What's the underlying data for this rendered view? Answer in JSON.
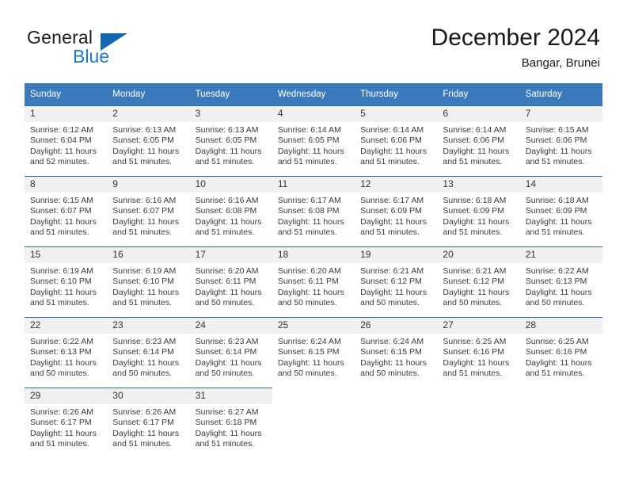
{
  "brand": {
    "name_top": "General",
    "name_bottom": "Blue",
    "accent_color": "#1a7ac4",
    "triangle_color": "#1368b0"
  },
  "header": {
    "title": "December 2024",
    "subtitle": "Bangar, Brunei"
  },
  "calendar": {
    "header_color": "#3b79bd",
    "daynum_band_color": "#f0f0f0",
    "weekdays": [
      "Sunday",
      "Monday",
      "Tuesday",
      "Wednesday",
      "Thursday",
      "Friday",
      "Saturday"
    ],
    "weeks": [
      [
        {
          "day": "1",
          "sunrise": "Sunrise: 6:12 AM",
          "sunset": "Sunset: 6:04 PM",
          "daylight": "Daylight: 11 hours and 52 minutes."
        },
        {
          "day": "2",
          "sunrise": "Sunrise: 6:13 AM",
          "sunset": "Sunset: 6:05 PM",
          "daylight": "Daylight: 11 hours and 51 minutes."
        },
        {
          "day": "3",
          "sunrise": "Sunrise: 6:13 AM",
          "sunset": "Sunset: 6:05 PM",
          "daylight": "Daylight: 11 hours and 51 minutes."
        },
        {
          "day": "4",
          "sunrise": "Sunrise: 6:14 AM",
          "sunset": "Sunset: 6:05 PM",
          "daylight": "Daylight: 11 hours and 51 minutes."
        },
        {
          "day": "5",
          "sunrise": "Sunrise: 6:14 AM",
          "sunset": "Sunset: 6:06 PM",
          "daylight": "Daylight: 11 hours and 51 minutes."
        },
        {
          "day": "6",
          "sunrise": "Sunrise: 6:14 AM",
          "sunset": "Sunset: 6:06 PM",
          "daylight": "Daylight: 11 hours and 51 minutes."
        },
        {
          "day": "7",
          "sunrise": "Sunrise: 6:15 AM",
          "sunset": "Sunset: 6:06 PM",
          "daylight": "Daylight: 11 hours and 51 minutes."
        }
      ],
      [
        {
          "day": "8",
          "sunrise": "Sunrise: 6:15 AM",
          "sunset": "Sunset: 6:07 PM",
          "daylight": "Daylight: 11 hours and 51 minutes."
        },
        {
          "day": "9",
          "sunrise": "Sunrise: 6:16 AM",
          "sunset": "Sunset: 6:07 PM",
          "daylight": "Daylight: 11 hours and 51 minutes."
        },
        {
          "day": "10",
          "sunrise": "Sunrise: 6:16 AM",
          "sunset": "Sunset: 6:08 PM",
          "daylight": "Daylight: 11 hours and 51 minutes."
        },
        {
          "day": "11",
          "sunrise": "Sunrise: 6:17 AM",
          "sunset": "Sunset: 6:08 PM",
          "daylight": "Daylight: 11 hours and 51 minutes."
        },
        {
          "day": "12",
          "sunrise": "Sunrise: 6:17 AM",
          "sunset": "Sunset: 6:09 PM",
          "daylight": "Daylight: 11 hours and 51 minutes."
        },
        {
          "day": "13",
          "sunrise": "Sunrise: 6:18 AM",
          "sunset": "Sunset: 6:09 PM",
          "daylight": "Daylight: 11 hours and 51 minutes."
        },
        {
          "day": "14",
          "sunrise": "Sunrise: 6:18 AM",
          "sunset": "Sunset: 6:09 PM",
          "daylight": "Daylight: 11 hours and 51 minutes."
        }
      ],
      [
        {
          "day": "15",
          "sunrise": "Sunrise: 6:19 AM",
          "sunset": "Sunset: 6:10 PM",
          "daylight": "Daylight: 11 hours and 51 minutes."
        },
        {
          "day": "16",
          "sunrise": "Sunrise: 6:19 AM",
          "sunset": "Sunset: 6:10 PM",
          "daylight": "Daylight: 11 hours and 51 minutes."
        },
        {
          "day": "17",
          "sunrise": "Sunrise: 6:20 AM",
          "sunset": "Sunset: 6:11 PM",
          "daylight": "Daylight: 11 hours and 50 minutes."
        },
        {
          "day": "18",
          "sunrise": "Sunrise: 6:20 AM",
          "sunset": "Sunset: 6:11 PM",
          "daylight": "Daylight: 11 hours and 50 minutes."
        },
        {
          "day": "19",
          "sunrise": "Sunrise: 6:21 AM",
          "sunset": "Sunset: 6:12 PM",
          "daylight": "Daylight: 11 hours and 50 minutes."
        },
        {
          "day": "20",
          "sunrise": "Sunrise: 6:21 AM",
          "sunset": "Sunset: 6:12 PM",
          "daylight": "Daylight: 11 hours and 50 minutes."
        },
        {
          "day": "21",
          "sunrise": "Sunrise: 6:22 AM",
          "sunset": "Sunset: 6:13 PM",
          "daylight": "Daylight: 11 hours and 50 minutes."
        }
      ],
      [
        {
          "day": "22",
          "sunrise": "Sunrise: 6:22 AM",
          "sunset": "Sunset: 6:13 PM",
          "daylight": "Daylight: 11 hours and 50 minutes."
        },
        {
          "day": "23",
          "sunrise": "Sunrise: 6:23 AM",
          "sunset": "Sunset: 6:14 PM",
          "daylight": "Daylight: 11 hours and 50 minutes."
        },
        {
          "day": "24",
          "sunrise": "Sunrise: 6:23 AM",
          "sunset": "Sunset: 6:14 PM",
          "daylight": "Daylight: 11 hours and 50 minutes."
        },
        {
          "day": "25",
          "sunrise": "Sunrise: 6:24 AM",
          "sunset": "Sunset: 6:15 PM",
          "daylight": "Daylight: 11 hours and 50 minutes."
        },
        {
          "day": "26",
          "sunrise": "Sunrise: 6:24 AM",
          "sunset": "Sunset: 6:15 PM",
          "daylight": "Daylight: 11 hours and 50 minutes."
        },
        {
          "day": "27",
          "sunrise": "Sunrise: 6:25 AM",
          "sunset": "Sunset: 6:16 PM",
          "daylight": "Daylight: 11 hours and 51 minutes."
        },
        {
          "day": "28",
          "sunrise": "Sunrise: 6:25 AM",
          "sunset": "Sunset: 6:16 PM",
          "daylight": "Daylight: 11 hours and 51 minutes."
        }
      ],
      [
        {
          "day": "29",
          "sunrise": "Sunrise: 6:26 AM",
          "sunset": "Sunset: 6:17 PM",
          "daylight": "Daylight: 11 hours and 51 minutes."
        },
        {
          "day": "30",
          "sunrise": "Sunrise: 6:26 AM",
          "sunset": "Sunset: 6:17 PM",
          "daylight": "Daylight: 11 hours and 51 minutes."
        },
        {
          "day": "31",
          "sunrise": "Sunrise: 6:27 AM",
          "sunset": "Sunset: 6:18 PM",
          "daylight": "Daylight: 11 hours and 51 minutes."
        },
        {
          "day": "",
          "sunrise": "",
          "sunset": "",
          "daylight": ""
        },
        {
          "day": "",
          "sunrise": "",
          "sunset": "",
          "daylight": ""
        },
        {
          "day": "",
          "sunrise": "",
          "sunset": "",
          "daylight": ""
        },
        {
          "day": "",
          "sunrise": "",
          "sunset": "",
          "daylight": ""
        }
      ]
    ]
  }
}
